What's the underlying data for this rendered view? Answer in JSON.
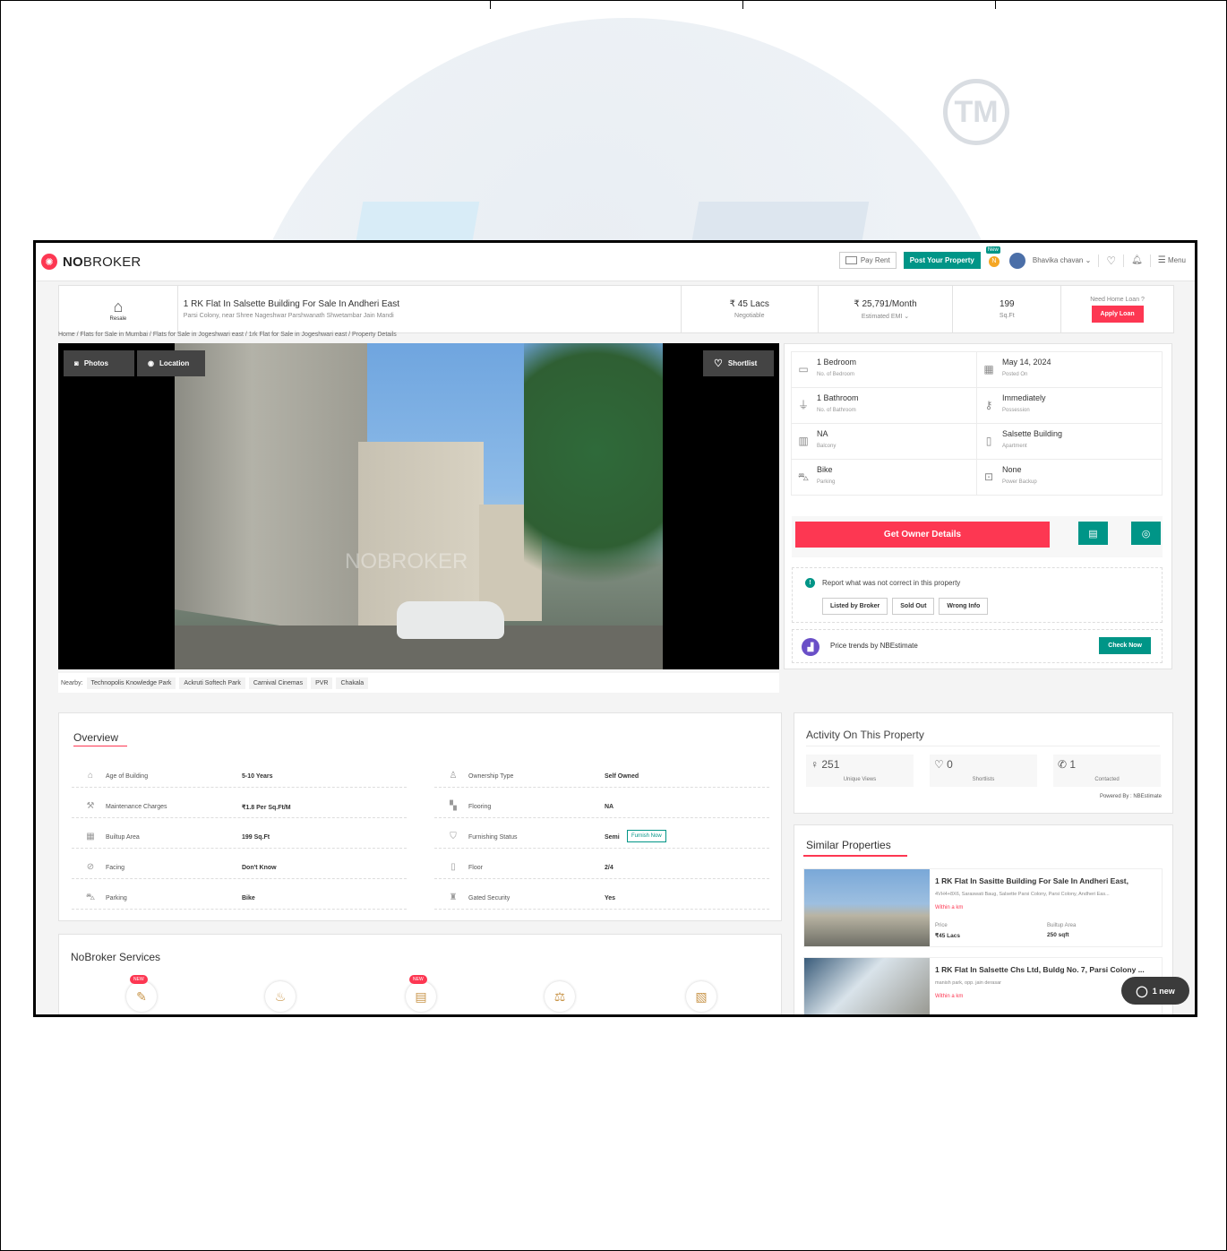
{
  "colors": {
    "brand_red": "#fd3752",
    "brand_green": "#009587"
  },
  "topbar": {
    "logo_bold": "NO",
    "logo_rest": "BROKER",
    "pay_rent": "Pay Rent",
    "post_property": "Post Your Property",
    "new_tag": "New",
    "user_name": "Bhavika chavan",
    "menu": "Menu"
  },
  "header": {
    "type_label": "Resale",
    "title": "1 RK Flat In Salsette Building For Sale In Andheri East",
    "address": "Parsi Colony, near Shree Nageshwar Parshwanath Shwetambar Jain Mandi",
    "price": "₹ 45 Lacs",
    "price_note": "Negotiable",
    "emi": "₹ 25,791/Month",
    "emi_note": "Estimated EMI",
    "area": "199",
    "area_unit": "Sq.Ft",
    "loan_q": "Need Home Loan ?",
    "apply_loan": "Apply Loan"
  },
  "breadcrumb": "Home / Flats for Sale in Mumbai / Flats for Sale in Jogeshwari east / 1rk Flat for Sale in Jogeshwari east / Property Details",
  "gallery": {
    "photos": "Photos",
    "location": "Location",
    "shortlist": "Shortlist",
    "watermark": "NOBROKER"
  },
  "nearby": {
    "label": "Nearby:",
    "places": [
      "Technopolis Knowledge Park",
      "Ackruti Softech Park",
      "Carnival Cinemas",
      "PVR",
      "Chakala"
    ]
  },
  "specs": [
    {
      "value": "1 Bedroom",
      "label": "No. of Bedroom",
      "icon": "bed-icon"
    },
    {
      "value": "May 14, 2024",
      "label": "Posted On",
      "icon": "calendar-icon"
    },
    {
      "value": "1 Bathroom",
      "label": "No. of Bathroom",
      "icon": "bathtub-icon"
    },
    {
      "value": "Immediately",
      "label": "Possession",
      "icon": "key-icon"
    },
    {
      "value": "NA",
      "label": "Balcony",
      "icon": "balcony-icon"
    },
    {
      "value": "Salsette Building",
      "label": "Apartment",
      "icon": "building-icon"
    },
    {
      "value": "Bike",
      "label": "Parking",
      "icon": "car-icon"
    },
    {
      "value": "None",
      "label": "Power Backup",
      "icon": "battery-icon"
    }
  ],
  "actions": {
    "owner_details": "Get Owner Details"
  },
  "report": {
    "text": "Report what was not correct in this property",
    "buttons": [
      "Listed by Broker",
      "Sold Out",
      "Wrong Info"
    ]
  },
  "trend": {
    "text": "Price trends by NBEstimate",
    "button": "Check Now"
  },
  "overview": {
    "title": "Overview",
    "rows": [
      {
        "label": "Age of Building",
        "value": "5-10 Years"
      },
      {
        "label": "Ownership Type",
        "value": "Self Owned"
      },
      {
        "label": "Maintenance Charges",
        "value": "₹1.8 Per Sq.Ft/M"
      },
      {
        "label": "Flooring",
        "value": "NA"
      },
      {
        "label": "Builtup Area",
        "value": "199 Sq.Ft"
      },
      {
        "label": "Furnishing Status",
        "value": "Semi"
      },
      {
        "label": "Facing",
        "value": "Don't Know"
      },
      {
        "label": "Floor",
        "value": "2/4"
      },
      {
        "label": "Parking",
        "value": "Bike"
      },
      {
        "label": "Gated Security",
        "value": "Yes"
      }
    ],
    "furnish_now": "Furnish Now"
  },
  "activity": {
    "title": "Activity On This Property",
    "views": "251",
    "views_label": "Unique Views",
    "shortlists": "0",
    "shortlists_label": "Shortlists",
    "contacted": "1",
    "contacted_label": "Contacted",
    "powered": "Powered By : NBEstimate"
  },
  "similar": {
    "title": "Similar Properties",
    "items": [
      {
        "title": "1 RK Flat In Sasitte Building For Sale In Andheri East,",
        "address": "4VH4+8X6, Saraswati Baug, Salsette Parsi Colony, Parsi Colony, Andheri Eas...",
        "within": "Within a km",
        "price_label": "Price",
        "price": "₹45 Lacs",
        "area_label": "Builtup Area",
        "area": "250 sqft"
      },
      {
        "title": "1 RK Flat In Salsette Chs Ltd, Buldg No. 7, Parsi Colony ...",
        "address": "manish park, opp. jain derasar",
        "within": "Within a km"
      }
    ]
  },
  "services": {
    "title": "NoBroker Services",
    "new_label": "NEW"
  },
  "chat": {
    "label": "1 new"
  }
}
